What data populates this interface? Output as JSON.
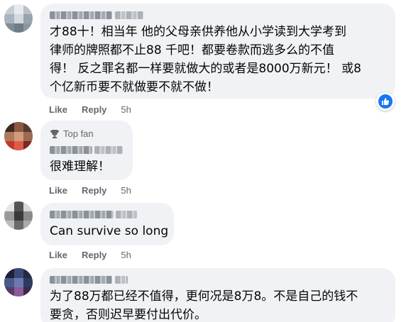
{
  "colors": {
    "bubble_bg": "#f0f2f5",
    "action_gray": "#65676b",
    "text_black": "#050505",
    "like_blue": "#1877f2"
  },
  "comments": [
    {
      "text": "才88十！相当年 他的父母亲供养他从小学读到大学考到\n律师的牌照都不止88 千吧！都要卷款而逃多么的不值\n得！ 反之罪名都一样要就做大的或者是8000万新元！ 或8\n个亿新币要不就做要不就不做！",
      "like": "Like",
      "reply": "Reply",
      "time": "5h",
      "reaction_icon": "thumbs-up-icon"
    },
    {
      "badge": "Top fan",
      "badge_icon": "trophy-icon",
      "text": "很难理解！",
      "like": "Like",
      "reply": "Reply",
      "time": "5h"
    },
    {
      "text": "Can survive so long",
      "like": "Like",
      "reply": "Reply",
      "time": "5h"
    },
    {
      "text": "为了88万都已经不值得，更何况是8万8。不是自己的钱不\n要贪，否则迟早要付出代价。"
    }
  ]
}
